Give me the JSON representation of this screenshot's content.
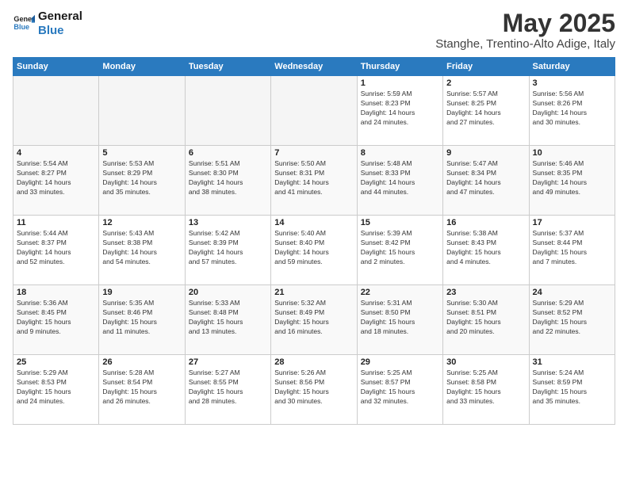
{
  "logo": {
    "line1": "General",
    "line2": "Blue"
  },
  "title": "May 2025",
  "location": "Stanghe, Trentino-Alto Adige, Italy",
  "days_of_week": [
    "Sunday",
    "Monday",
    "Tuesday",
    "Wednesday",
    "Thursday",
    "Friday",
    "Saturday"
  ],
  "weeks": [
    [
      {
        "day": "",
        "info": ""
      },
      {
        "day": "",
        "info": ""
      },
      {
        "day": "",
        "info": ""
      },
      {
        "day": "",
        "info": ""
      },
      {
        "day": "1",
        "info": "Sunrise: 5:59 AM\nSunset: 8:23 PM\nDaylight: 14 hours\nand 24 minutes."
      },
      {
        "day": "2",
        "info": "Sunrise: 5:57 AM\nSunset: 8:25 PM\nDaylight: 14 hours\nand 27 minutes."
      },
      {
        "day": "3",
        "info": "Sunrise: 5:56 AM\nSunset: 8:26 PM\nDaylight: 14 hours\nand 30 minutes."
      }
    ],
    [
      {
        "day": "4",
        "info": "Sunrise: 5:54 AM\nSunset: 8:27 PM\nDaylight: 14 hours\nand 33 minutes."
      },
      {
        "day": "5",
        "info": "Sunrise: 5:53 AM\nSunset: 8:29 PM\nDaylight: 14 hours\nand 35 minutes."
      },
      {
        "day": "6",
        "info": "Sunrise: 5:51 AM\nSunset: 8:30 PM\nDaylight: 14 hours\nand 38 minutes."
      },
      {
        "day": "7",
        "info": "Sunrise: 5:50 AM\nSunset: 8:31 PM\nDaylight: 14 hours\nand 41 minutes."
      },
      {
        "day": "8",
        "info": "Sunrise: 5:48 AM\nSunset: 8:33 PM\nDaylight: 14 hours\nand 44 minutes."
      },
      {
        "day": "9",
        "info": "Sunrise: 5:47 AM\nSunset: 8:34 PM\nDaylight: 14 hours\nand 47 minutes."
      },
      {
        "day": "10",
        "info": "Sunrise: 5:46 AM\nSunset: 8:35 PM\nDaylight: 14 hours\nand 49 minutes."
      }
    ],
    [
      {
        "day": "11",
        "info": "Sunrise: 5:44 AM\nSunset: 8:37 PM\nDaylight: 14 hours\nand 52 minutes."
      },
      {
        "day": "12",
        "info": "Sunrise: 5:43 AM\nSunset: 8:38 PM\nDaylight: 14 hours\nand 54 minutes."
      },
      {
        "day": "13",
        "info": "Sunrise: 5:42 AM\nSunset: 8:39 PM\nDaylight: 14 hours\nand 57 minutes."
      },
      {
        "day": "14",
        "info": "Sunrise: 5:40 AM\nSunset: 8:40 PM\nDaylight: 14 hours\nand 59 minutes."
      },
      {
        "day": "15",
        "info": "Sunrise: 5:39 AM\nSunset: 8:42 PM\nDaylight: 15 hours\nand 2 minutes."
      },
      {
        "day": "16",
        "info": "Sunrise: 5:38 AM\nSunset: 8:43 PM\nDaylight: 15 hours\nand 4 minutes."
      },
      {
        "day": "17",
        "info": "Sunrise: 5:37 AM\nSunset: 8:44 PM\nDaylight: 15 hours\nand 7 minutes."
      }
    ],
    [
      {
        "day": "18",
        "info": "Sunrise: 5:36 AM\nSunset: 8:45 PM\nDaylight: 15 hours\nand 9 minutes."
      },
      {
        "day": "19",
        "info": "Sunrise: 5:35 AM\nSunset: 8:46 PM\nDaylight: 15 hours\nand 11 minutes."
      },
      {
        "day": "20",
        "info": "Sunrise: 5:33 AM\nSunset: 8:48 PM\nDaylight: 15 hours\nand 13 minutes."
      },
      {
        "day": "21",
        "info": "Sunrise: 5:32 AM\nSunset: 8:49 PM\nDaylight: 15 hours\nand 16 minutes."
      },
      {
        "day": "22",
        "info": "Sunrise: 5:31 AM\nSunset: 8:50 PM\nDaylight: 15 hours\nand 18 minutes."
      },
      {
        "day": "23",
        "info": "Sunrise: 5:30 AM\nSunset: 8:51 PM\nDaylight: 15 hours\nand 20 minutes."
      },
      {
        "day": "24",
        "info": "Sunrise: 5:29 AM\nSunset: 8:52 PM\nDaylight: 15 hours\nand 22 minutes."
      }
    ],
    [
      {
        "day": "25",
        "info": "Sunrise: 5:29 AM\nSunset: 8:53 PM\nDaylight: 15 hours\nand 24 minutes."
      },
      {
        "day": "26",
        "info": "Sunrise: 5:28 AM\nSunset: 8:54 PM\nDaylight: 15 hours\nand 26 minutes."
      },
      {
        "day": "27",
        "info": "Sunrise: 5:27 AM\nSunset: 8:55 PM\nDaylight: 15 hours\nand 28 minutes."
      },
      {
        "day": "28",
        "info": "Sunrise: 5:26 AM\nSunset: 8:56 PM\nDaylight: 15 hours\nand 30 minutes."
      },
      {
        "day": "29",
        "info": "Sunrise: 5:25 AM\nSunset: 8:57 PM\nDaylight: 15 hours\nand 32 minutes."
      },
      {
        "day": "30",
        "info": "Sunrise: 5:25 AM\nSunset: 8:58 PM\nDaylight: 15 hours\nand 33 minutes."
      },
      {
        "day": "31",
        "info": "Sunrise: 5:24 AM\nSunset: 8:59 PM\nDaylight: 15 hours\nand 35 minutes."
      }
    ]
  ]
}
